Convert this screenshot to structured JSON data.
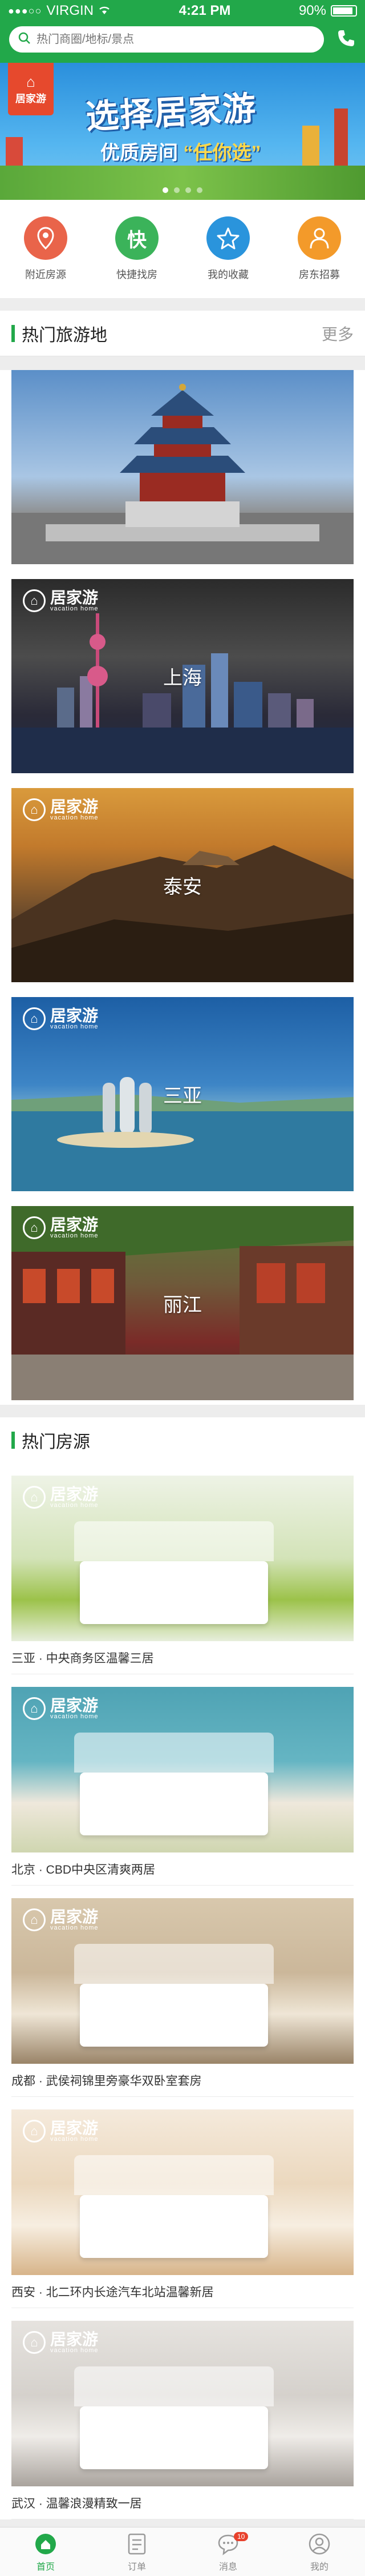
{
  "status_bar": {
    "carrier": "VIRGIN",
    "time": "4:21 PM",
    "battery": "90%"
  },
  "search": {
    "placeholder": "热门商圈/地标/景点"
  },
  "banner": {
    "logo_text": "居家游",
    "title": "选择居家游",
    "subtitle_prefix": "优质房间",
    "subtitle_highlight": "“任你选”",
    "pages": 4,
    "active_page": 0
  },
  "quick_nav": [
    {
      "label": "附近房源",
      "icon": "location-pin-icon",
      "color": "#e9644a"
    },
    {
      "label": "快捷找房",
      "icon": "quick-icon",
      "glyph": "快",
      "color": "#3bb35a"
    },
    {
      "label": "我的收藏",
      "icon": "star-icon",
      "color": "#2a94dc"
    },
    {
      "label": "房东招募",
      "icon": "person-icon",
      "color": "#f39a2a"
    }
  ],
  "destinations": {
    "title": "热门旅游地",
    "more": "更多",
    "items": [
      {
        "name": ""
      },
      {
        "name": "上海"
      },
      {
        "name": "泰安"
      },
      {
        "name": "三亚"
      },
      {
        "name": "丽江"
      }
    ]
  },
  "watermark": {
    "brand": "居家游",
    "tagline": "vacation home"
  },
  "rooms": {
    "title": "热门房源",
    "items": [
      {
        "caption": "三亚 · 中央商务区温馨三居"
      },
      {
        "caption": "北京 · CBD中央区清爽两居"
      },
      {
        "caption": "成都 · 武侯祠锦里旁豪华双卧室套房"
      },
      {
        "caption": "西安 · 北二环内长途汽车北站温馨新居"
      },
      {
        "caption": "武汉 · 温馨浪漫精致一居"
      }
    ]
  },
  "tab_bar": [
    {
      "label": "首页",
      "icon": "home-icon",
      "active": true
    },
    {
      "label": "订单",
      "icon": "order-icon",
      "active": false
    },
    {
      "label": "消息",
      "icon": "message-icon",
      "badge": "10",
      "active": false
    },
    {
      "label": "我的",
      "icon": "profile-icon",
      "active": false
    }
  ],
  "colors": {
    "brand_green": "#22a84a",
    "accent_red": "#e8412c"
  }
}
